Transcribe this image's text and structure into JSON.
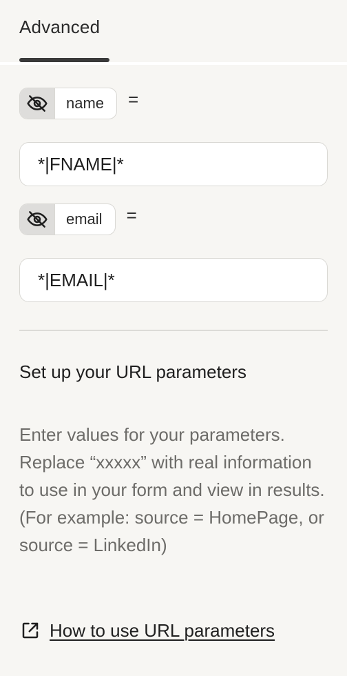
{
  "tabs": {
    "active_label": "Advanced"
  },
  "params": [
    {
      "name": "name",
      "equals": "=",
      "value": "*|FNAME|*"
    },
    {
      "name": "email",
      "equals": "=",
      "value": "*|EMAIL|*"
    }
  ],
  "section": {
    "title": "Set up your URL parameters",
    "help_text": "Enter values for your parameters. Replace “xxxxx” with real information to use in your form and view in results. (For example: source = HomePage, or source = LinkedIn)",
    "link_label": "How to use URL parameters"
  },
  "icons": {
    "visibility": "eye-off-icon",
    "link": "external-link-icon"
  },
  "colors": {
    "background": "#f7f6f3",
    "muted_text": "#6d6c69",
    "chip_icon_bg": "#dedddb",
    "border": "#d9d8d4"
  }
}
